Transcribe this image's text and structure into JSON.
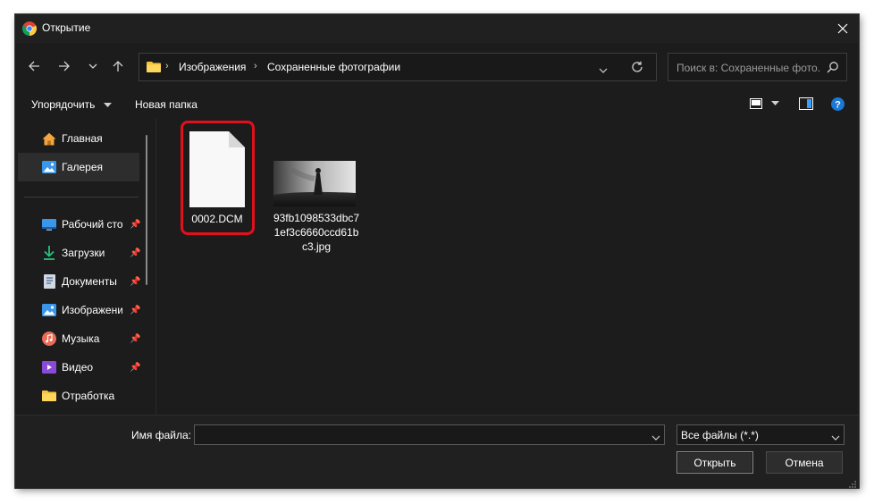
{
  "window": {
    "title": "Открытие"
  },
  "address": {
    "crumbs": [
      "Изображения",
      "Сохраненные фотографии"
    ]
  },
  "search": {
    "placeholder": "Поиск в: Сохраненные фото..."
  },
  "commandbar": {
    "organize_label": "Упорядочить",
    "new_folder_label": "Новая папка"
  },
  "sidebar": {
    "top_items": [
      {
        "label": "Главная",
        "icon": "home-icon"
      },
      {
        "label": "Галерея",
        "icon": "gallery-icon",
        "selected": true
      }
    ],
    "pinned_items": [
      {
        "label": "Рабочий стол",
        "icon": "desktop-icon",
        "pinned": true
      },
      {
        "label": "Загрузки",
        "icon": "download-icon",
        "pinned": true
      },
      {
        "label": "Документы",
        "icon": "documents-icon",
        "pinned": true
      },
      {
        "label": "Изображения",
        "icon": "pictures-icon",
        "pinned": true
      },
      {
        "label": "Музыка",
        "icon": "music-icon",
        "pinned": true
      },
      {
        "label": "Видео",
        "icon": "video-icon",
        "pinned": true
      },
      {
        "label": "Отработка",
        "icon": "folder-icon",
        "pinned": false
      }
    ]
  },
  "files": [
    {
      "name": "0002.DCM",
      "type": "document",
      "highlighted": true
    },
    {
      "name_lines": [
        "93fb1098533dbc7",
        "1ef3c6660ccd61b",
        "c3.jpg"
      ],
      "type": "image"
    }
  ],
  "bottom": {
    "filename_label": "Имя файла:",
    "filename_value": "",
    "filetype_value": "Все файлы (*.*)",
    "open_label": "Открыть",
    "cancel_label": "Отмена"
  },
  "colors": {
    "highlight": "#e0101c",
    "accent": "#0078d4",
    "bg": "#1c1c1c"
  }
}
